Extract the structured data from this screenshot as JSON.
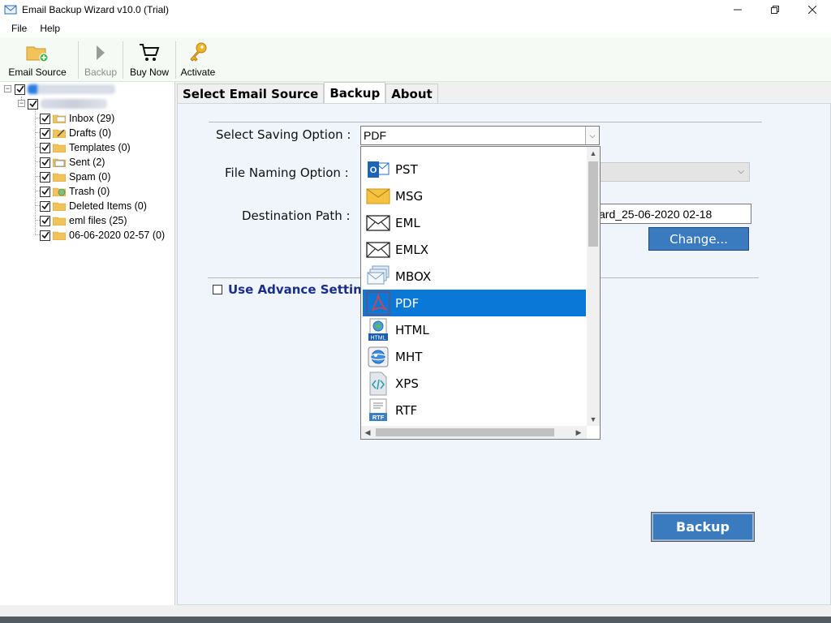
{
  "window": {
    "title": "Email Backup Wizard v10.0 (Trial)"
  },
  "menu": [
    "File",
    "Help"
  ],
  "toolbar": {
    "email_source": "Email Source",
    "backup": "Backup",
    "buy_now": "Buy Now",
    "activate": "Activate"
  },
  "tree": {
    "folders": [
      {
        "label": "Inbox (29)",
        "icon": "inbox-folder-icon"
      },
      {
        "label": "Drafts (0)",
        "icon": "drafts-folder-icon"
      },
      {
        "label": "Templates (0)",
        "icon": "folder-icon"
      },
      {
        "label": "Sent (2)",
        "icon": "sent-folder-icon"
      },
      {
        "label": "Spam (0)",
        "icon": "folder-icon"
      },
      {
        "label": "Trash (0)",
        "icon": "trash-folder-icon"
      },
      {
        "label": "Deleted Items (0)",
        "icon": "folder-icon"
      },
      {
        "label": "eml files (25)",
        "icon": "folder-icon"
      },
      {
        "label": "06-06-2020 02-57 (0)",
        "icon": "folder-icon"
      }
    ]
  },
  "tabs": [
    "Select Email Source",
    "Backup",
    "About"
  ],
  "form": {
    "saving_label": "Select Saving Option :",
    "saving_value": "PDF",
    "naming_label": "File Naming Option :",
    "dest_label": "Destination Path :",
    "dest_value": "ard_25-06-2020 02-18",
    "change_label": "Change...",
    "advance_label": "Use Advance Settings",
    "backup_label": "Backup"
  },
  "dropdown": {
    "options": [
      {
        "label": "PST",
        "icon": "outlook-pst-icon"
      },
      {
        "label": "MSG",
        "icon": "envelope-yellow-icon"
      },
      {
        "label": "EML",
        "icon": "envelope-icon"
      },
      {
        "label": "EMLX",
        "icon": "envelope-icon"
      },
      {
        "label": "MBOX",
        "icon": "mbox-stack-icon"
      },
      {
        "label": "PDF",
        "icon": "pdf-icon"
      },
      {
        "label": "HTML",
        "icon": "html-icon"
      },
      {
        "label": "MHT",
        "icon": "mht-globe-icon"
      },
      {
        "label": "XPS",
        "icon": "xps-code-icon"
      },
      {
        "label": "RTF",
        "icon": "rtf-icon"
      }
    ],
    "selected": "PDF"
  },
  "colors": {
    "accent": "#0a78d7",
    "button": "#3a7abf",
    "link": "#1a2e8a"
  }
}
